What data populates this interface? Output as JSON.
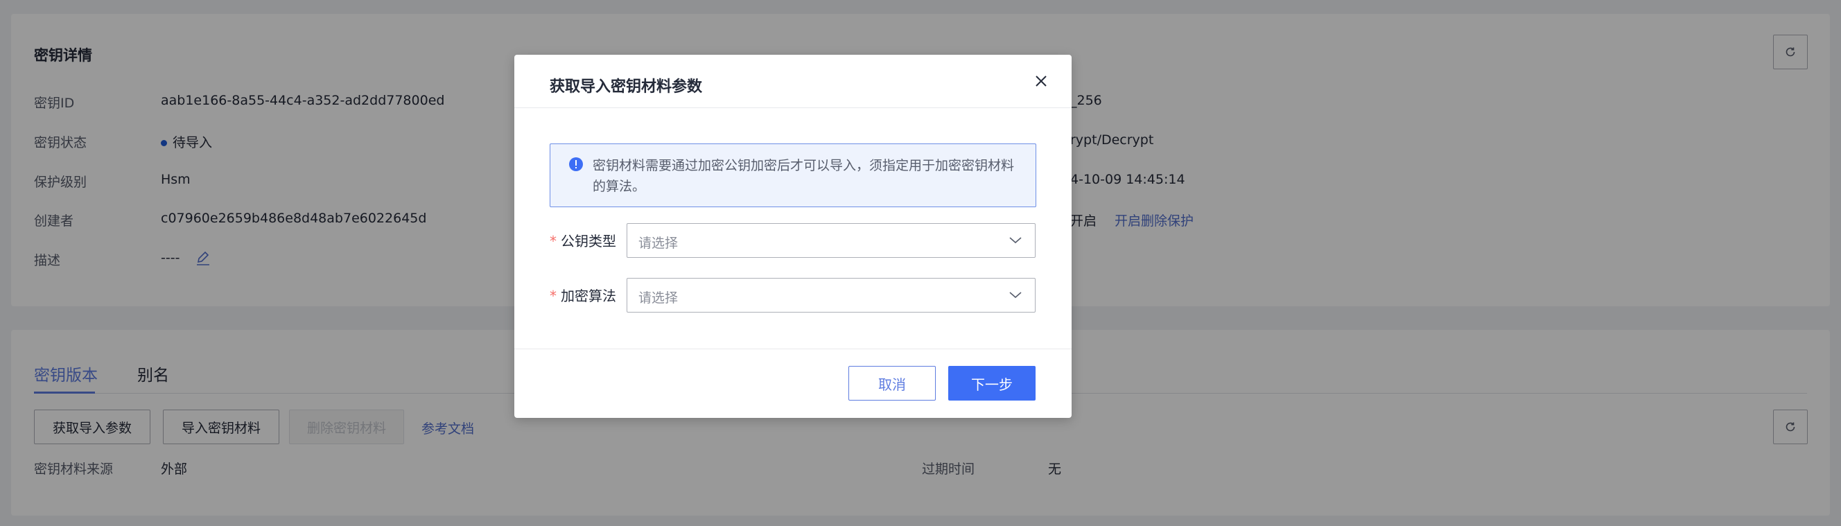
{
  "detail": {
    "title": "密钥详情",
    "rows": [
      {
        "label": "密钥ID",
        "value": "aab1e166-8a55-44c4-a352-ad2dd77800ed"
      },
      {
        "label": "密钥状态",
        "value": "待导入"
      },
      {
        "label": "保护级别",
        "value": "Hsm"
      },
      {
        "label": "创建者",
        "value": "c07960e2659b486e8d48ab7e6022645d"
      },
      {
        "label": "描述",
        "value": "----"
      }
    ],
    "right_values": {
      "algorithm_fragment": "_256",
      "usage_fragment": "rypt/Decrypt",
      "created_time_fragment": "4-10-09 14:45:14",
      "protection_status_fragment": "开启",
      "protection_link": "开启删除保护"
    }
  },
  "versions": {
    "tabs": [
      {
        "label": "密钥版本",
        "active": true
      },
      {
        "label": "别名",
        "active": false
      }
    ],
    "buttons": {
      "get_params": "获取导入参数",
      "import_material": "导入密钥材料",
      "delete_material": "删除密钥材料",
      "docs_link": "参考文档"
    },
    "source_label": "密钥材料来源",
    "source_value": "外部",
    "expiry_label": "过期时间",
    "expiry_value": "无"
  },
  "dialog": {
    "title": "获取导入密钥材料参数",
    "notice": "密钥材料需要通过加密公钥加密后才可以导入，须指定用于加密密钥材料的算法。",
    "fields": [
      {
        "label": "公钥类型",
        "placeholder": "请选择"
      },
      {
        "label": "加密算法",
        "placeholder": "请选择"
      }
    ],
    "cancel_label": "取消",
    "next_label": "下一步"
  },
  "colors": {
    "primary": "#3d6ef5",
    "link": "#526ecc",
    "required": "#f66f6a",
    "notice_border": "#6e8fe6",
    "status_dot": "#1f5bd8"
  }
}
